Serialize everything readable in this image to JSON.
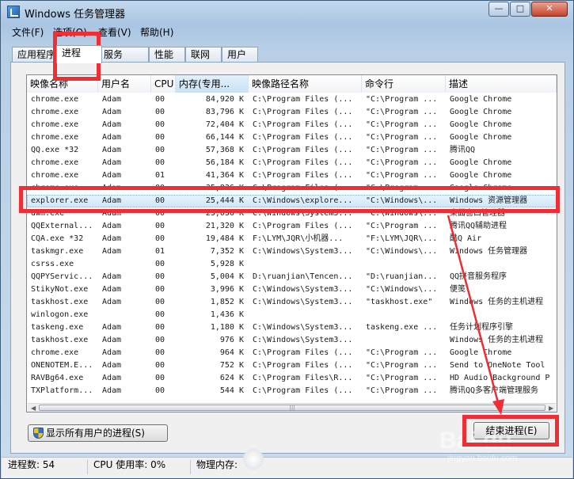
{
  "window": {
    "title": "Windows 任务管理器",
    "controls": {
      "minimize": "—",
      "maximize": "□",
      "close": "✕"
    }
  },
  "menu": {
    "items": [
      "文件(F)",
      "选项(O)",
      "查看(V)",
      "帮助(H)"
    ]
  },
  "tabs": {
    "items": [
      "应用程序",
      "进程",
      "服务",
      "性能",
      "联网",
      "用户"
    ],
    "active": "进程"
  },
  "table": {
    "columns": [
      "映像名称",
      "用户名",
      "CPU",
      "内存(专用...",
      "映像路径名称",
      "命令行",
      "描述"
    ],
    "sorted_column": "内存(专用...",
    "selected_row_index": 8,
    "rows": [
      [
        "chrome.exe",
        "Adam",
        "00",
        "84,920 K",
        "C:\\Program Files (...",
        "\"C:\\Program ...",
        "Google Chrome"
      ],
      [
        "chrome.exe",
        "Adam",
        "00",
        "83,796 K",
        "C:\\Program Files (...",
        "\"C:\\Program ...",
        "Google Chrome"
      ],
      [
        "chrome.exe",
        "Adam",
        "00",
        "72,404 K",
        "C:\\Program Files (...",
        "\"C:\\Program ...",
        "Google Chrome"
      ],
      [
        "chrome.exe",
        "Adam",
        "00",
        "66,144 K",
        "C:\\Program Files (...",
        "\"C:\\Program ...",
        "Google Chrome"
      ],
      [
        "QQ.exe *32",
        "Adam",
        "00",
        "57,368 K",
        "C:\\Program Files (...",
        "\"C:\\Program ...",
        "腾讯QQ"
      ],
      [
        "chrome.exe",
        "Adam",
        "00",
        "56,184 K",
        "C:\\Program Files (...",
        "\"C:\\Program ...",
        "Google Chrome"
      ],
      [
        "chrome.exe",
        "Adam",
        "01",
        "41,364 K",
        "C:\\Program Files (...",
        "\"C:\\Program ...",
        "Google Chrome"
      ],
      [
        "chrome.exe",
        "Adam",
        "00",
        "35,836 K",
        "C:\\Program Files (...",
        "\"C:\\Program ...",
        "Google Chrome"
      ],
      [
        "explorer.exe",
        "Adam",
        "00",
        "25,444 K",
        "C:\\Windows\\explore...",
        "\"C:\\Windows\\...",
        "Windows 资源管理器"
      ],
      [
        "dwm.exe",
        "Adam",
        "00",
        "23,036 K",
        "C:\\Windows\\System3...",
        "\"C:\\Windows\\...",
        "桌面窗口管理器"
      ],
      [
        "QQExternal...",
        "Adam",
        "00",
        "21,320 K",
        "C:\\Program Files (...",
        "\"C:\\Program ...",
        "腾讯QQ辅助进程"
      ],
      [
        "CQA.exe *32",
        "Adam",
        "00",
        "19,484 K",
        "F:\\LYM\\JQR\\小机器...",
        "\"F:\\LYM\\JQR\\...",
        "酷Q Air"
      ],
      [
        "taskmgr.exe",
        "Adam",
        "01",
        "7,352 K",
        "C:\\Windows\\System3...",
        "\"C:\\Windows\\...",
        "Windows 任务管理器"
      ],
      [
        "csrss.exe",
        "",
        "00",
        "5,928 K",
        "",
        "",
        ""
      ],
      [
        "QQPYServic...",
        "Adam",
        "00",
        "5,004 K",
        "D:\\ruanjian\\Tencen...",
        "\"D:\\ruanjian...",
        "QQ拼音服务程序"
      ],
      [
        "StikyNot.exe",
        "Adam",
        "00",
        "3,996 K",
        "C:\\Windows\\System3...",
        "\"C:\\Windows\\...",
        "便笺"
      ],
      [
        "taskhost.exe",
        "Adam",
        "00",
        "1,852 K",
        "C:\\Windows\\System3...",
        "\"taskhost.exe\"",
        "Windows 任务的主机进程"
      ],
      [
        "winlogon.exe",
        "",
        "00",
        "1,436 K",
        "",
        "",
        ""
      ],
      [
        "taskeng.exe",
        "Adam",
        "00",
        "1,180 K",
        "C:\\Windows\\System3...",
        "taskeng.exe ...",
        "任务计划程序引擎"
      ],
      [
        "taskhost.exe",
        "Adam",
        "00",
        "976 K",
        "C:\\Windows\\System3...",
        "",
        "Windows 任务的主机进程"
      ],
      [
        "chrome.exe",
        "Adam",
        "00",
        "964 K",
        "C:\\Program Files (...",
        "\"C:\\Program ...",
        "Google Chrome"
      ],
      [
        "ONENOTEM.E...",
        "Adam",
        "00",
        "752 K",
        "C:\\Program Files (...",
        "\"C:\\Program ...",
        "Send to OneNote Tool"
      ],
      [
        "RAVBg64.exe",
        "Adam",
        "00",
        "624 K",
        "C:\\Program Files\\R...",
        "\"C:\\Program ...",
        "HD Audio Background P"
      ],
      [
        "TXPlatform...",
        "Adam",
        "00",
        "544 K",
        "C:\\Program Files (...",
        "\"C:\\Program ...",
        "腾讯QQ多客户端管理服务"
      ]
    ]
  },
  "buttons": {
    "show_all": "显示所有用户的进程(S)",
    "end_process": "结束进程(E)"
  },
  "status": {
    "processes": "进程数: 54",
    "cpu": "CPU 使用率: 0%",
    "memory": "物理内存:"
  },
  "watermark": {
    "logo": "Bai du",
    "sub": "jingyan.baidu.com"
  },
  "annotation_color": "#ee2d35",
  "selection_color": "#cde6fa"
}
